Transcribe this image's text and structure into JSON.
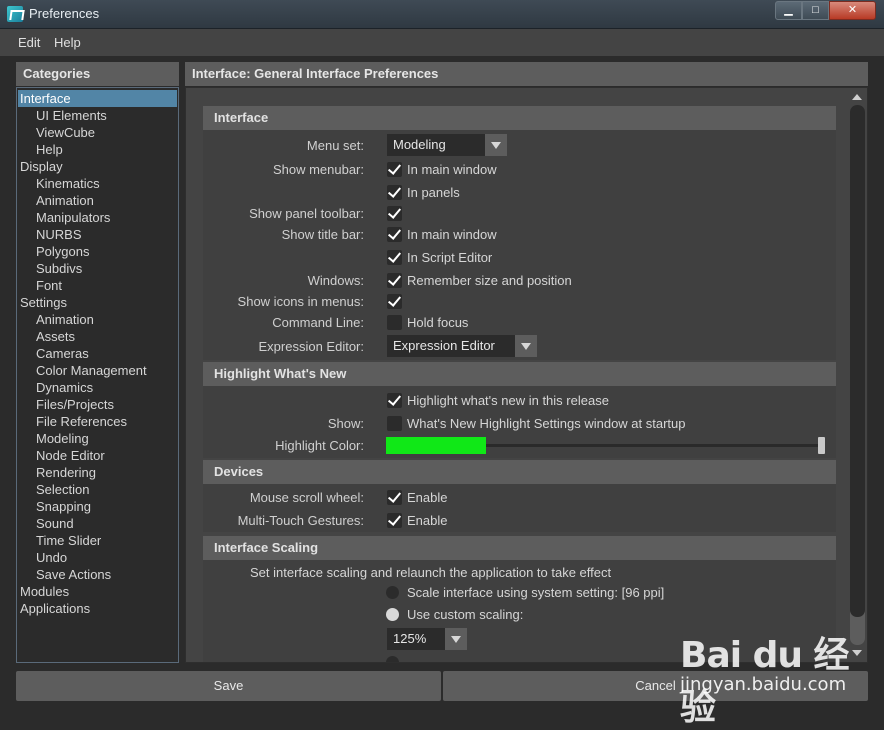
{
  "window": {
    "title": "Preferences",
    "min_label": "▁",
    "max_label": "□",
    "close_label": "✕"
  },
  "menubar": {
    "items": [
      "Edit",
      "Help"
    ]
  },
  "categories": {
    "header": "Categories",
    "items": [
      {
        "label": "Interface",
        "level": 0,
        "selected": true
      },
      {
        "label": "UI Elements",
        "level": 1
      },
      {
        "label": "ViewCube",
        "level": 1
      },
      {
        "label": "Help",
        "level": 1
      },
      {
        "label": "Display",
        "level": 0
      },
      {
        "label": "Kinematics",
        "level": 1
      },
      {
        "label": "Animation",
        "level": 1
      },
      {
        "label": "Manipulators",
        "level": 1
      },
      {
        "label": "NURBS",
        "level": 1
      },
      {
        "label": "Polygons",
        "level": 1
      },
      {
        "label": "Subdivs",
        "level": 1
      },
      {
        "label": "Font",
        "level": 1
      },
      {
        "label": "Settings",
        "level": 0
      },
      {
        "label": "Animation",
        "level": 1
      },
      {
        "label": "Assets",
        "level": 1
      },
      {
        "label": "Cameras",
        "level": 1
      },
      {
        "label": "Color Management",
        "level": 1
      },
      {
        "label": "Dynamics",
        "level": 1
      },
      {
        "label": "Files/Projects",
        "level": 1
      },
      {
        "label": "File References",
        "level": 1
      },
      {
        "label": "Modeling",
        "level": 1
      },
      {
        "label": "Node Editor",
        "level": 1
      },
      {
        "label": "Rendering",
        "level": 1
      },
      {
        "label": "Selection",
        "level": 1
      },
      {
        "label": "Snapping",
        "level": 1
      },
      {
        "label": "Sound",
        "level": 1
      },
      {
        "label": "Time Slider",
        "level": 1
      },
      {
        "label": "Undo",
        "level": 1
      },
      {
        "label": "Save Actions",
        "level": 1
      },
      {
        "label": "Modules",
        "level": 0
      },
      {
        "label": "Applications",
        "level": 0
      }
    ]
  },
  "panel": {
    "header": "Interface: General Interface Preferences"
  },
  "interface": {
    "title": "Interface",
    "menu_set_label": "Menu set:",
    "menu_set_value": "Modeling",
    "show_menubar_label": "Show menubar:",
    "in_main_window": "In main window",
    "in_panels": "In panels",
    "show_panel_toolbar_label": "Show panel toolbar:",
    "show_title_bar_label": "Show title bar:",
    "title_in_main_window": "In main window",
    "in_script_editor": "In Script Editor",
    "windows_label": "Windows:",
    "remember_size": "Remember size and position",
    "show_icons_label": "Show icons in menus:",
    "command_line_label": "Command Line:",
    "hold_focus": "Hold focus",
    "expression_editor_label": "Expression Editor:",
    "expression_editor_value": "Expression Editor"
  },
  "highlight": {
    "title": "Highlight What's New",
    "highlight_release": "Highlight what's new in this release",
    "show_label": "Show:",
    "show_settings": "What's New Highlight Settings window at startup",
    "color_label": "Highlight Color:",
    "color": "#10e817",
    "slider_level": 1.0
  },
  "devices": {
    "title": "Devices",
    "mouse_label": "Mouse scroll wheel:",
    "mouse_value": "Enable",
    "touch_label": "Multi-Touch Gestures:",
    "touch_value": "Enable"
  },
  "scaling": {
    "title": "Interface Scaling",
    "description": "Set interface scaling and relaunch the application to take effect",
    "system_setting": "Scale interface using system setting: [96 ppi]",
    "custom_scaling": "Use custom scaling:",
    "custom_value": "125%"
  },
  "buttons": {
    "save": "Save",
    "cancel": "Cancel"
  },
  "watermark": {
    "logo": "Bai du 经验",
    "sub": "jingyan.baidu.com"
  }
}
